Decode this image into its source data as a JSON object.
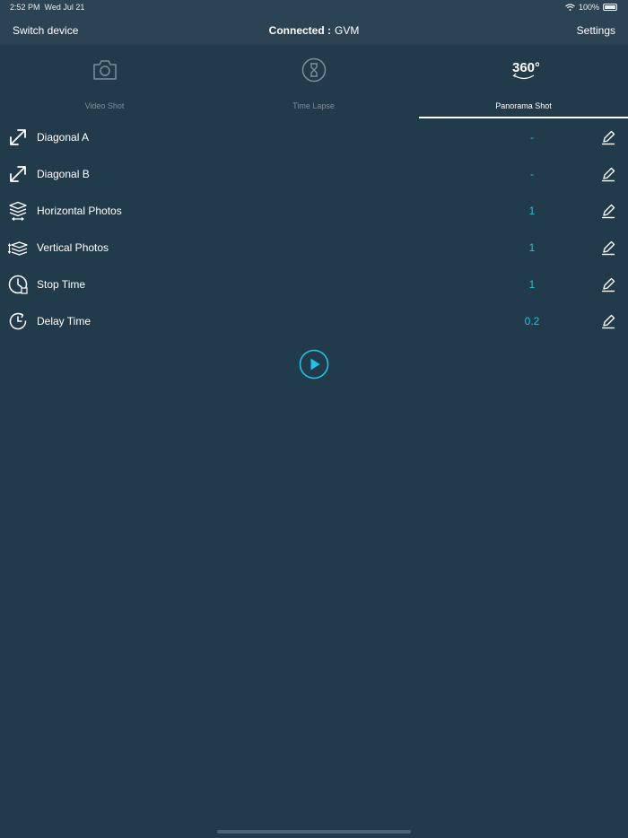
{
  "status_bar": {
    "time": "2:52 PM",
    "date": "Wed Jul 21",
    "battery": "100%"
  },
  "nav": {
    "left": "Switch device",
    "connected_label": "Connected :",
    "device_name": "GVM",
    "right": "Settings"
  },
  "tabs": [
    {
      "label": "Video Shot",
      "icon": "camera-icon",
      "active": false
    },
    {
      "label": "Time Lapse",
      "icon": "hourglass-icon",
      "active": false
    },
    {
      "label": "Panorama Shot",
      "icon": "panorama-360-icon",
      "icon_text": "360°",
      "active": true
    }
  ],
  "rows": [
    {
      "label": "Diagonal A",
      "value": "-",
      "icon": "diagonal-arrow-icon"
    },
    {
      "label": "Diagonal B",
      "value": "-",
      "icon": "diagonal-arrow-icon"
    },
    {
      "label": "Horizontal Photos",
      "value": "1",
      "icon": "horizontal-layers-icon"
    },
    {
      "label": "Vertical Photos",
      "value": "1",
      "icon": "vertical-layers-icon"
    },
    {
      "label": "Stop Time",
      "value": "1",
      "icon": "stop-time-clock-icon"
    },
    {
      "label": "Delay Time",
      "value": "0.2",
      "icon": "delay-time-clock-icon"
    }
  ],
  "colors": {
    "background": "#213b4b",
    "header": "#2b4352",
    "accent": "#1ec3e6",
    "inactive": "#7c8e99"
  }
}
